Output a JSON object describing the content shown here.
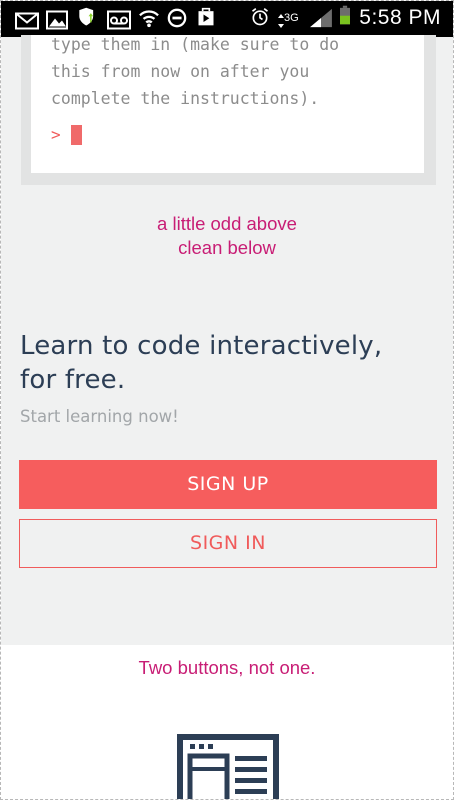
{
  "status_bar": {
    "time": "5:58 PM",
    "network": "3G",
    "icons": [
      "email-icon",
      "gallery-icon",
      "shield-icon",
      "voicemail-icon",
      "wifi-icon",
      "do-not-disturb-icon",
      "play-store-icon",
      "alarm-icon",
      "network-icon",
      "signal-icon",
      "battery-icon"
    ]
  },
  "console": {
    "lines": [
      "type them in (make sure to do",
      "this from now on after you",
      "complete the instructions)."
    ],
    "prompt": ">"
  },
  "notes": {
    "top_line1": "a little odd above",
    "top_line2": "clean below",
    "bottom": "Two buttons, not one."
  },
  "hero": {
    "headline_line1": "Learn to code interactively,",
    "headline_line2": "for free.",
    "subline": "Start learning now!"
  },
  "buttons": {
    "signup": "SIGN UP",
    "signin": "SIGN IN"
  },
  "colors": {
    "accent": "#f65d5d",
    "note": "#c81d75",
    "heading": "#2c3e55",
    "page_bg": "#f0f1f1"
  }
}
